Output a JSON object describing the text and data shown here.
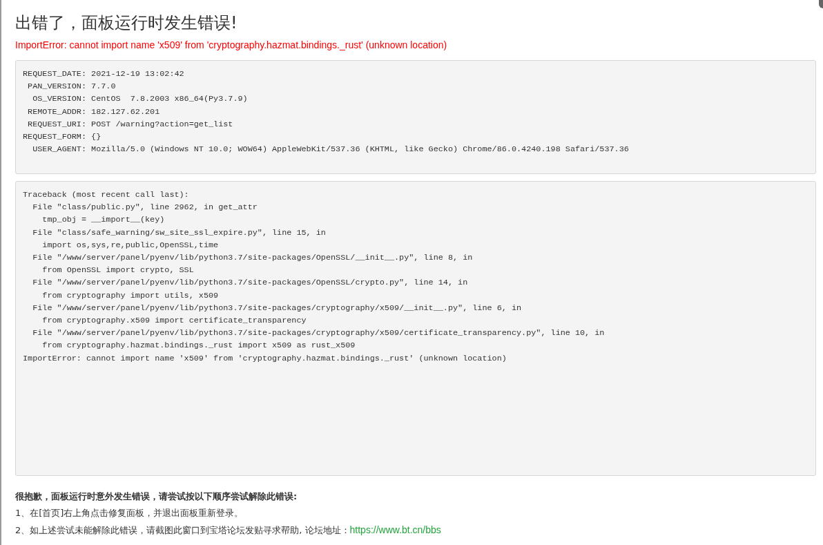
{
  "title": "出错了，面板运行时发生错误!",
  "error_message": "ImportError: cannot import name 'x509' from 'cryptography.hazmat.bindings._rust' (unknown location)",
  "request_info": [
    "REQUEST_DATE: 2021-12-19 13:02:42",
    " PAN_VERSION: 7.7.0",
    "  OS_VERSION: CentOS  7.8.2003 x86_64(Py3.7.9)",
    " REMOTE_ADDR: 182.127.62.201",
    " REQUEST_URI: POST /warning?action=get_list",
    "REQUEST_FORM: {}",
    "  USER_AGENT: Mozilla/5.0 (Windows NT 10.0; WOW64) AppleWebKit/537.36 (KHTML, like Gecko) Chrome/86.0.4240.198 Safari/537.36"
  ],
  "traceback": [
    "Traceback (most recent call last):",
    "  File \"class/public.py\", line 2962, in get_attr",
    "    tmp_obj = __import__(key)",
    "  File \"class/safe_warning/sw_site_ssl_expire.py\", line 15, in",
    "    import os,sys,re,public,OpenSSL,time",
    "  File \"/www/server/panel/pyenv/lib/python3.7/site-packages/OpenSSL/__init__.py\", line 8, in",
    "    from OpenSSL import crypto, SSL",
    "  File \"/www/server/panel/pyenv/lib/python3.7/site-packages/OpenSSL/crypto.py\", line 14, in",
    "    from cryptography import utils, x509",
    "  File \"/www/server/panel/pyenv/lib/python3.7/site-packages/cryptography/x509/__init__.py\", line 6, in",
    "    from cryptography.x509 import certificate_transparency",
    "  File \"/www/server/panel/pyenv/lib/python3.7/site-packages/cryptography/x509/certificate_transparency.py\", line 10, in",
    "    from cryptography.hazmat.bindings._rust import x509 as rust_x509",
    "ImportError: cannot import name 'x509' from 'cryptography.hazmat.bindings._rust' (unknown location)"
  ],
  "help": {
    "heading": "很抱歉，面板运行时意外发生错误，请尝试按以下顺序尝试解除此错误:",
    "steps": [
      {
        "text": "1、在[首页]右上角点击修复面板，并退出面板重新登录。"
      },
      {
        "text": "2、如上述尝试未能解除此错误，请截图此窗口到宝塔论坛发贴寻求帮助, 论坛地址：",
        "link": "https://www.bt.cn/bbs"
      }
    ]
  }
}
